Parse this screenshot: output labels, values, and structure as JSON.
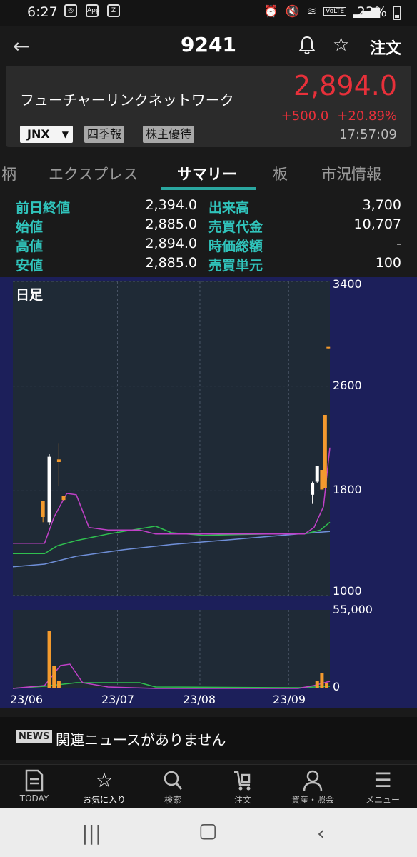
{
  "status_bar": {
    "time": "6:27",
    "battery": "23%",
    "app_icon_a": "App",
    "volte": "VoLTE"
  },
  "header": {
    "code": "9241",
    "order_label": "注文"
  },
  "stock": {
    "name": "フューチャーリンクネットワーク",
    "price": "2,894.0",
    "change": "+500.0",
    "change_pct": "+20.89%",
    "time": "17:57:09",
    "market": "JNX",
    "tag_quarterly": "四季報",
    "tag_benefit": "株主優待"
  },
  "tabs": [
    "柄",
    "エクスプレス",
    "サマリー",
    "板",
    "市況情報"
  ],
  "summary": {
    "left": [
      {
        "label": "前日終値",
        "value": "2,394.0"
      },
      {
        "label": "始値",
        "value": "2,885.0"
      },
      {
        "label": "高値",
        "value": "2,894.0"
      },
      {
        "label": "安値",
        "value": "2,885.0"
      }
    ],
    "right": [
      {
        "label": "出来高",
        "value": "3,700"
      },
      {
        "label": "売買代金",
        "value": "10,707"
      },
      {
        "label": "時価総額",
        "value": "-"
      },
      {
        "label": "売買単元",
        "value": "100"
      }
    ]
  },
  "chart": {
    "period": "日足",
    "price_axis": [
      "3400",
      "2600",
      "1800",
      "1000"
    ],
    "volume_axis": [
      "55,000",
      "0"
    ],
    "x_axis": [
      "23/06",
      "23/07",
      "23/08",
      "23/09"
    ]
  },
  "chart_data": {
    "type": "candlestick",
    "price_ylim": [
      1000,
      3400
    ],
    "volume_ylim": [
      0,
      55000
    ],
    "candles": [
      {
        "x": 0.095,
        "o": 1720,
        "c": 1600,
        "h": 1720,
        "l": 1560,
        "color": "orange"
      },
      {
        "x": 0.115,
        "o": 1560,
        "c": 2060,
        "h": 2080,
        "l": 1540,
        "color": "white"
      },
      {
        "x": 0.145,
        "o": 2020,
        "c": 2040,
        "h": 2160,
        "l": 1840,
        "color": "orange"
      },
      {
        "x": 0.16,
        "o": 1760,
        "c": 1730,
        "h": 1760,
        "l": 1730,
        "color": "orange"
      },
      {
        "x": 0.945,
        "o": 1770,
        "c": 1860,
        "h": 1870,
        "l": 1700,
        "color": "white"
      },
      {
        "x": 0.96,
        "o": 1870,
        "c": 1990,
        "h": 1990,
        "l": 1860,
        "color": "white"
      },
      {
        "x": 0.975,
        "o": 1810,
        "c": 1960,
        "h": 1960,
        "l": 1810,
        "color": "orange"
      },
      {
        "x": 0.985,
        "o": 1820,
        "c": 2380,
        "h": 2380,
        "l": 1820,
        "color": "orange"
      },
      {
        "x": 0.995,
        "o": 2900,
        "c": 2894,
        "h": 2900,
        "l": 2885,
        "color": "orange"
      }
    ],
    "volumes": [
      {
        "x": 0.115,
        "v": 40000
      },
      {
        "x": 0.13,
        "v": 16000
      },
      {
        "x": 0.145,
        "v": 5000
      },
      {
        "x": 0.96,
        "v": 5000
      },
      {
        "x": 0.975,
        "v": 11000
      },
      {
        "x": 0.99,
        "v": 3700
      }
    ],
    "ma_short": [
      [
        0.0,
        1400
      ],
      [
        0.1,
        1400
      ],
      [
        0.13,
        1600
      ],
      [
        0.17,
        1780
      ],
      [
        0.2,
        1770
      ],
      [
        0.24,
        1520
      ],
      [
        0.3,
        1500
      ],
      [
        0.4,
        1500
      ],
      [
        0.45,
        1470
      ],
      [
        0.6,
        1470
      ],
      [
        0.7,
        1470
      ],
      [
        0.8,
        1470
      ],
      [
        0.92,
        1470
      ],
      [
        0.95,
        1520
      ],
      [
        0.98,
        1680
      ],
      [
        1.0,
        2130
      ]
    ],
    "ma_mid": [
      [
        0.0,
        1320
      ],
      [
        0.1,
        1320
      ],
      [
        0.14,
        1380
      ],
      [
        0.2,
        1420
      ],
      [
        0.3,
        1470
      ],
      [
        0.45,
        1530
      ],
      [
        0.5,
        1480
      ],
      [
        0.6,
        1460
      ],
      [
        0.8,
        1470
      ],
      [
        0.92,
        1470
      ],
      [
        0.97,
        1500
      ],
      [
        1.0,
        1560
      ]
    ],
    "ma_long": [
      [
        0.0,
        1220
      ],
      [
        0.1,
        1240
      ],
      [
        0.2,
        1300
      ],
      [
        0.35,
        1350
      ],
      [
        0.5,
        1390
      ],
      [
        0.7,
        1430
      ],
      [
        0.9,
        1470
      ],
      [
        1.0,
        1490
      ]
    ],
    "vol_ma_short": [
      [
        0.0,
        0
      ],
      [
        0.1,
        2000
      ],
      [
        0.15,
        16000
      ],
      [
        0.18,
        17000
      ],
      [
        0.22,
        4000
      ],
      [
        0.3,
        1000
      ],
      [
        0.45,
        0
      ],
      [
        0.9,
        0
      ],
      [
        0.95,
        2000
      ],
      [
        1.0,
        5000
      ]
    ],
    "vol_ma_long": [
      [
        0.0,
        0
      ],
      [
        0.1,
        1500
      ],
      [
        0.2,
        4000
      ],
      [
        0.4,
        4000
      ],
      [
        0.45,
        1000
      ],
      [
        0.9,
        500
      ],
      [
        1.0,
        1500
      ]
    ]
  },
  "news": {
    "badge": "NEWS",
    "text": "関連ニュースがありません"
  },
  "bottom_nav": [
    {
      "label": "TODAY",
      "icon": "today-icon"
    },
    {
      "label": "お気に入り",
      "icon": "star-icon"
    },
    {
      "label": "検索",
      "icon": "search-icon"
    },
    {
      "label": "注文",
      "icon": "cart-icon"
    },
    {
      "label": "資産・照会",
      "icon": "person-icon"
    },
    {
      "label": "メニュー",
      "icon": "menu-icon"
    }
  ]
}
